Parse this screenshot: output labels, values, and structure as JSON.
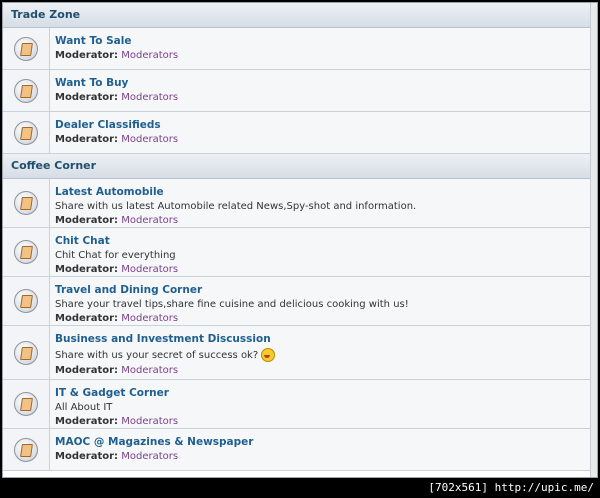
{
  "categories": [
    {
      "name": "Trade Zone",
      "forums": [
        {
          "title": "Want To Sale",
          "desc": "",
          "mod_label": "Moderator:",
          "mod": "Moderators"
        },
        {
          "title": "Want To Buy",
          "desc": "",
          "mod_label": "Moderator:",
          "mod": "Moderators"
        },
        {
          "title": "Dealer Classifieds",
          "desc": "",
          "mod_label": "Moderator:",
          "mod": "Moderators"
        }
      ]
    },
    {
      "name": "Coffee Corner",
      "forums": [
        {
          "title": "Latest Automobile",
          "desc": "Share with us latest Automobile related News,Spy-shot and information.",
          "mod_label": "Moderator:",
          "mod": "Moderators"
        },
        {
          "title": "Chit Chat",
          "desc": "Chit Chat for everything",
          "mod_label": "Moderator:",
          "mod": "Moderators"
        },
        {
          "title": "Travel and Dining Corner",
          "desc": "Share your travel tips,share fine cuisine and delicious cooking with us!",
          "mod_label": "Moderator:",
          "mod": "Moderators"
        },
        {
          "title": "Business and Investment Discussion",
          "desc": "Share with us your secret of success ok?",
          "mod_label": "Moderator:",
          "mod": "Moderators",
          "emoji": "tongue-smiley-icon"
        },
        {
          "title": "IT & Gadget Corner",
          "desc": "All About IT",
          "mod_label": "Moderator:",
          "mod": "Moderators"
        },
        {
          "title": "MAOC @ Magazines & Newspaper",
          "desc": "",
          "mod_label": "Moderator:",
          "mod": "Moderators"
        }
      ]
    }
  ],
  "watermark": "[702x561] http://upic.me/"
}
